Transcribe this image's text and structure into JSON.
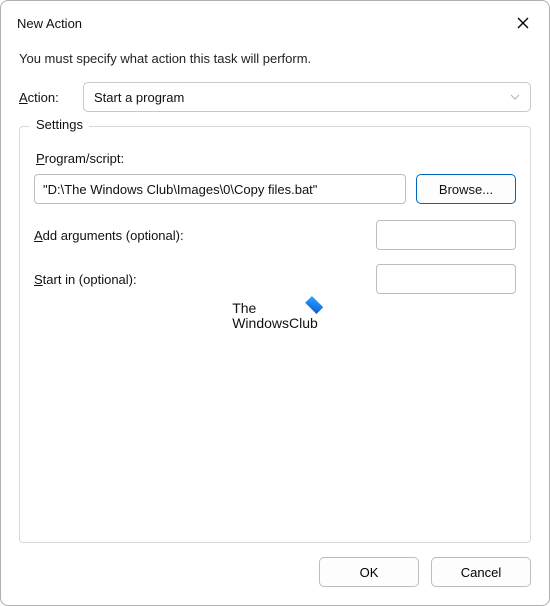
{
  "window": {
    "title": "New Action"
  },
  "instruction": "You must specify what action this task will perform.",
  "action": {
    "label": "Action:",
    "selected": "Start a program"
  },
  "settings": {
    "legend": "Settings",
    "program_label": "Program/script:",
    "program_value": "\"D:\\The Windows Club\\Images\\0\\Copy files.bat\"",
    "browse_label": "Browse...",
    "add_arguments_label": "Add arguments (optional):",
    "add_arguments_value": "",
    "start_in_label": "Start in (optional):",
    "start_in_value": ""
  },
  "watermark": {
    "line1": "The",
    "line2": "WindowsClub"
  },
  "buttons": {
    "ok": "OK",
    "cancel": "Cancel"
  }
}
